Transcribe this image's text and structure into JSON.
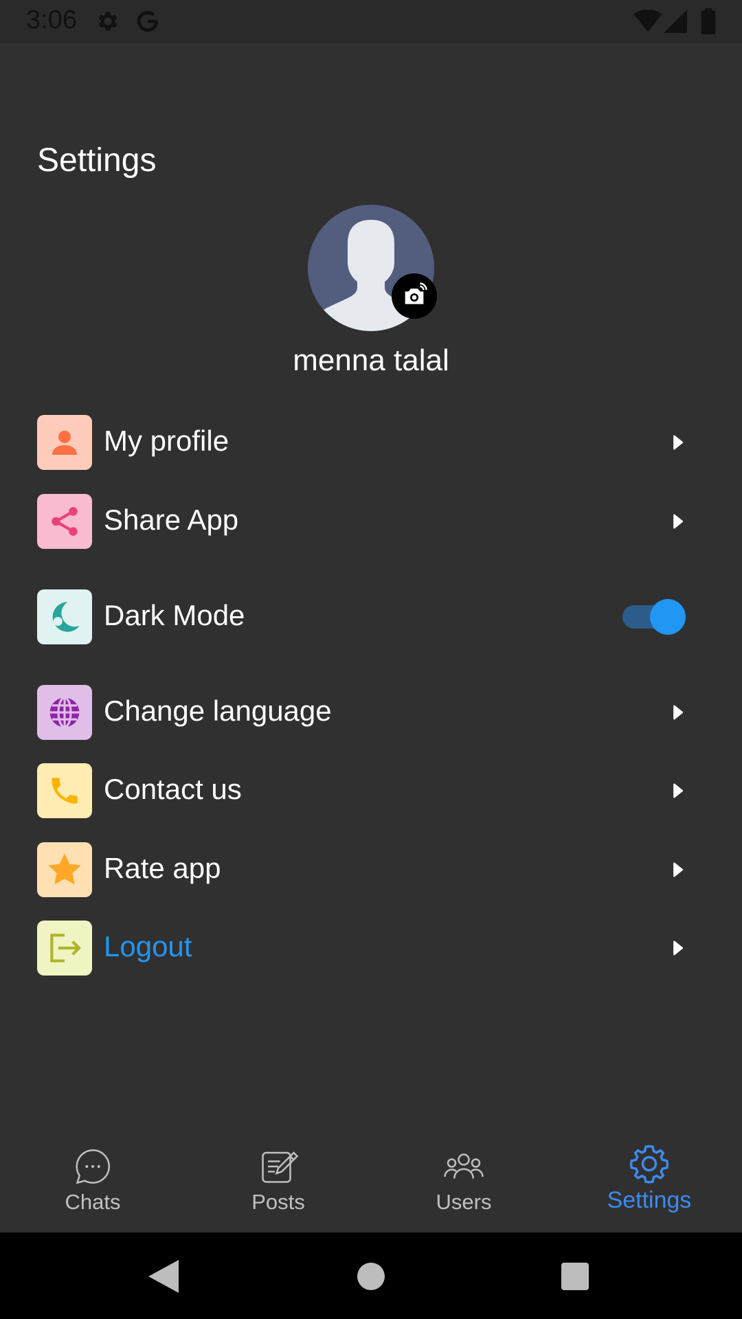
{
  "status_bar": {
    "time": "3:06"
  },
  "header": {
    "title": "Settings"
  },
  "profile": {
    "name": "menna talal"
  },
  "menu": {
    "items": [
      {
        "label": "My profile",
        "icon": "person-icon",
        "icon_bg": "#ffccbc",
        "icon_color": "#ff7043"
      },
      {
        "label": "Share App",
        "icon": "share-icon",
        "icon_bg": "#f8bbd0",
        "icon_color": "#ec407a"
      },
      {
        "label": "Dark Mode",
        "icon": "moon-icon",
        "icon_bg": "#e0f2f1",
        "icon_color": "#26a69a",
        "toggle_on": true
      },
      {
        "label": "Change language",
        "icon": "globe-icon",
        "icon_bg": "#e1bee7",
        "icon_color": "#8e24aa"
      },
      {
        "label": "Contact us",
        "icon": "phone-icon",
        "icon_bg": "#ffecb3",
        "icon_color": "#ffb300"
      },
      {
        "label": "Rate app",
        "icon": "star-icon",
        "icon_bg": "#ffe0b2",
        "icon_color": "#ffa726"
      },
      {
        "label": "Logout",
        "icon": "logout-icon",
        "icon_bg": "#f0f4c3",
        "icon_color": "#afb42b",
        "label_color": "#2196f3"
      }
    ]
  },
  "bottom_nav": {
    "items": [
      {
        "label": "Chats",
        "icon": "chat-bubble-icon"
      },
      {
        "label": "Posts",
        "icon": "edit-note-icon"
      },
      {
        "label": "Users",
        "icon": "users-icon"
      },
      {
        "label": "Settings",
        "icon": "gear-icon",
        "active": true
      }
    ]
  },
  "colors": {
    "background": "#303030",
    "accent": "#2196f3"
  }
}
